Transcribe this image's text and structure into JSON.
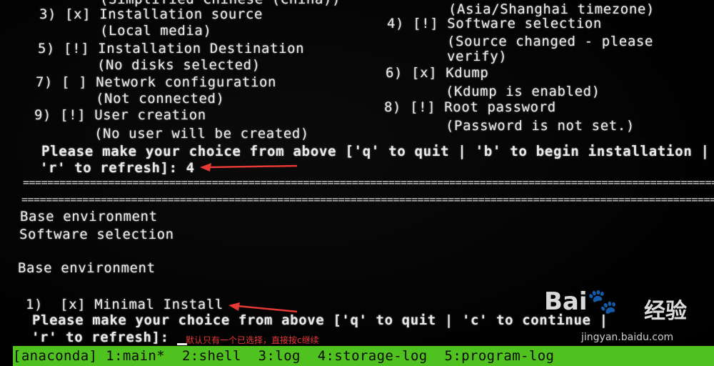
{
  "menu": {
    "top_cut": "(Simplified Chinese (China))",
    "tz_top": "(Asia/Shanghai timezone)",
    "item3": "3) [x] Installation source",
    "item3_sub": "(Local media)",
    "item5": "5) [!] Installation Destination",
    "item5_sub": "(No disks selected)",
    "item7": "7) [ ] Network configuration",
    "item7_sub": "(Not connected)",
    "item9": "9) [!] User creation",
    "item9_sub": "(No user will be created)",
    "item4": "4) [!] Software selection",
    "item4_sub1": "(Source changed - please",
    "item4_sub2": "verify)",
    "item6": "6) [x] Kdump",
    "item6_sub": "(Kdump is enabled)",
    "item8": "8) [!] Root password",
    "item8_sub": "(Password is not set.)"
  },
  "prompt1": {
    "line1": "Please make your choice from above ['q' to quit | 'b' to begin installation |",
    "line2": "'r' to refresh]: 4"
  },
  "separator": "==========================================================================================================================",
  "software": {
    "title1": "Base environment",
    "title2": "Software selection",
    "heading": "Base environment",
    "option1": "1)  [x] Minimal Install"
  },
  "prompt2": {
    "line1": "Please make your choice from above ['q' to quit | 'c' to continue |",
    "line2": "'r' to refresh]:"
  },
  "annotation": "默认只有一个已选择，直接按c继续",
  "statusbar": {
    "items": [
      "[anaconda] 1:main*",
      "2:shell",
      "3:log",
      "4:storage-log",
      "5:program-log"
    ]
  },
  "watermark": {
    "logo": "Bai🐾",
    "cn": "经验",
    "url": "jingyan.baidu.com"
  },
  "colors": {
    "status_bg": "#4fc21f",
    "arrow": "#e53935"
  }
}
